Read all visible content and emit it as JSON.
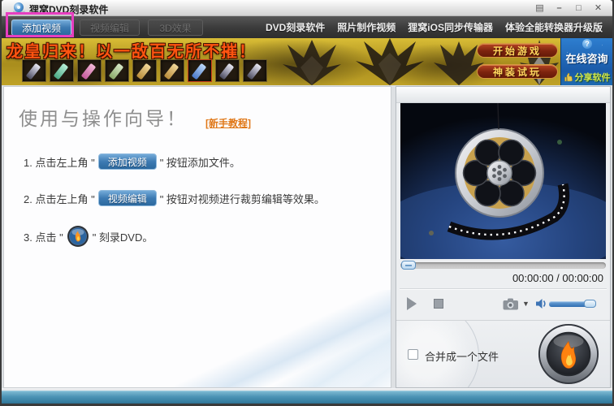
{
  "colors": {
    "accent_blue": "#3d7ab2",
    "annotation_magenta": "#e73ec0",
    "status_teal": "#4a92b4",
    "flame_orange": "#ff8210",
    "link_orange": "#e07818",
    "banner_gold": "#b99c22"
  },
  "window": {
    "title": "狸窝DVD刻录软件",
    "controls": {
      "menu_glyph": "▤",
      "minimize_glyph": "–",
      "maximize_glyph": "□",
      "close_glyph": "✕"
    }
  },
  "tab_bar": {
    "tabs": [
      {
        "label": "添加视频",
        "state": "active"
      },
      {
        "label": "视频编辑",
        "state": "disabled"
      },
      {
        "label": "3D效果",
        "state": "disabled"
      }
    ],
    "menu_links": [
      "DVD刻录软件",
      "照片制作视频",
      "狸窝iOS同步传输器",
      "体验全能转换器升级版"
    ]
  },
  "banner": {
    "headline": "龙皇归来！以一敌百无所不摧！",
    "start_game": "开始游戏",
    "trial_play": "神装试玩",
    "online_consult": "在线咨询",
    "share_software": "分享软件",
    "help_glyph": "?"
  },
  "guide": {
    "title": "使用与操作向导！",
    "tutorial_link": "[新手教程]",
    "steps": [
      {
        "prefix": "1. 点击左上角 \"",
        "button": "添加视频",
        "suffix": "\" 按钮添加文件。"
      },
      {
        "prefix": "2. 点击左上角 \"",
        "button": "视频编辑",
        "suffix": "\" 按钮对视频进行裁剪编辑等效果。"
      },
      {
        "prefix": "3. 点击 \"",
        "suffix": "\" 刻录DVD。"
      }
    ]
  },
  "player": {
    "time_display": "00:00:00 / 00:00:00",
    "dropdown_glyph": "▼"
  },
  "burn": {
    "merge_checkbox_label": "合并成一个文件",
    "merge_checked": false
  }
}
